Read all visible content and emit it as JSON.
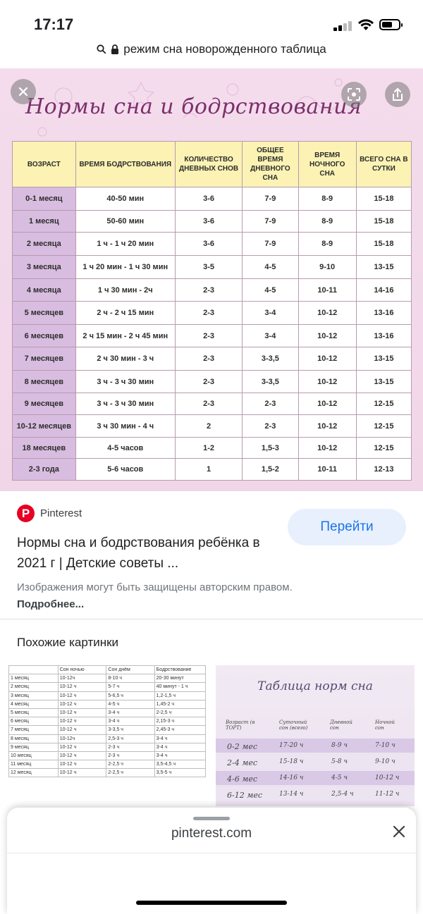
{
  "status": {
    "time": "17:17"
  },
  "browser": {
    "url_text": "режим сна новорожденного таблица"
  },
  "image": {
    "title": "Нормы сна и бодрствования",
    "table": {
      "headers": [
        "ВОЗРАСТ",
        "ВРЕМЯ БОДРСТВОВАНИЯ",
        "КОЛИЧЕСТВО ДНЕВНЫХ СНОВ",
        "ОБЩЕЕ ВРЕМЯ ДНЕВНОГО СНА",
        "ВРЕМЯ НОЧНОГО СНА",
        "ВСЕГО СНА В СУТКИ"
      ],
      "rows": [
        [
          "0-1 месяц",
          "40-50 мин",
          "3-6",
          "7-9",
          "8-9",
          "15-18"
        ],
        [
          "1 месяц",
          "50-60 мин",
          "3-6",
          "7-9",
          "8-9",
          "15-18"
        ],
        [
          "2 месяца",
          "1 ч - 1 ч 20 мин",
          "3-6",
          "7-9",
          "8-9",
          "15-18"
        ],
        [
          "3 месяца",
          "1 ч 20 мин - 1 ч 30 мин",
          "3-5",
          "4-5",
          "9-10",
          "13-15"
        ],
        [
          "4 месяца",
          "1 ч 30 мин - 2ч",
          "2-3",
          "4-5",
          "10-11",
          "14-16"
        ],
        [
          "5 месяцев",
          "2 ч - 2 ч 15 мин",
          "2-3",
          "3-4",
          "10-12",
          "13-16"
        ],
        [
          "6 месяцев",
          "2 ч 15 мин - 2 ч 45 мин",
          "2-3",
          "3-4",
          "10-12",
          "13-16"
        ],
        [
          "7 месяцев",
          "2 ч 30 мин - 3 ч",
          "2-3",
          "3-3,5",
          "10-12",
          "13-15"
        ],
        [
          "8 месяцев",
          "3 ч - 3 ч 30 мин",
          "2-3",
          "3-3,5",
          "10-12",
          "13-15"
        ],
        [
          "9 месяцев",
          "3 ч - 3 ч 30 мин",
          "2-3",
          "2-3",
          "10-12",
          "12-15"
        ],
        [
          "10-12 месяцев",
          "3 ч 30 мин - 4 ч",
          "2",
          "2-3",
          "10-12",
          "12-15"
        ],
        [
          "18 месяцев",
          "4-5 часов",
          "1-2",
          "1,5-3",
          "10-12",
          "12-15"
        ],
        [
          "2-3 года",
          "5-6 часов",
          "1",
          "1,5-2",
          "10-11",
          "12-13"
        ]
      ]
    }
  },
  "result": {
    "source": "Pinterest",
    "source_initial": "P",
    "go_button": "Перейти",
    "title": "Нормы сна и бодрствования ребёнка в 2021 г | Детские советы ...",
    "copyright_text": "Изображения могут быть защищены авторским правом.",
    "copyright_link": "Подробнее..."
  },
  "similar": {
    "heading": "Похожие картинки",
    "thumb1": {
      "headers": [
        "",
        "Сон ночью",
        "Сон днём",
        "Бодрствование"
      ],
      "rows": [
        [
          "1 месяц",
          "10-12ч",
          "8-10 ч",
          "20-30 минут"
        ],
        [
          "2 месяц",
          "10-12 ч",
          "5-7 ч",
          "40 минут - 1 ч"
        ],
        [
          "3 месяц",
          "10-12 ч",
          "5-6,5 ч",
          "1,2-1,5 ч"
        ],
        [
          "4 месяц",
          "10-12 ч",
          "4-5 ч",
          "1,45-2 ч"
        ],
        [
          "5 месяц",
          "10-12 ч",
          "3-4 ч",
          "2-2,5 ч"
        ],
        [
          "6 месяц",
          "10-12 ч",
          "3-4 ч",
          "2,15-3 ч"
        ],
        [
          "7 месяц",
          "10-12 ч",
          "3-3,5 ч",
          "2,45-3 ч"
        ],
        [
          "8 месяц",
          "10-12ч",
          "2,5-3 ч",
          "3-4 ч"
        ],
        [
          "9 месяц",
          "10-12 ч",
          "2-3 ч",
          "3-4 ч"
        ],
        [
          "10 месяц",
          "10-12 ч",
          "2-3 ч",
          "3-4 ч"
        ],
        [
          "11 месяц",
          "10-12 ч",
          "2-2,5 ч",
          "3,5-4,5 ч"
        ],
        [
          "12 месяц",
          "10-12 ч",
          "2-2,5 ч",
          "3,5-5 ч"
        ]
      ]
    },
    "thumb2": {
      "title": "Таблица норм сна",
      "headers": [
        "Возраст (в ТОРТ)",
        "Суточный сон (всего)",
        "Дневной сон",
        "Ночной сон"
      ],
      "rows": [
        [
          "0-2 мес",
          "17-20 ч",
          "8-9 ч",
          "7-10 ч"
        ],
        [
          "2-4 мес",
          "15-18 ч",
          "5-8 ч",
          "9-10 ч"
        ],
        [
          "4-6 мес",
          "14-16 ч",
          "4-5 ч",
          "10-12 ч"
        ],
        [
          "6-12 мес",
          "13-14 ч",
          "2,5-4 ч",
          "11-12 ч"
        ]
      ]
    }
  },
  "sheet": {
    "url": "pinterest.com"
  }
}
